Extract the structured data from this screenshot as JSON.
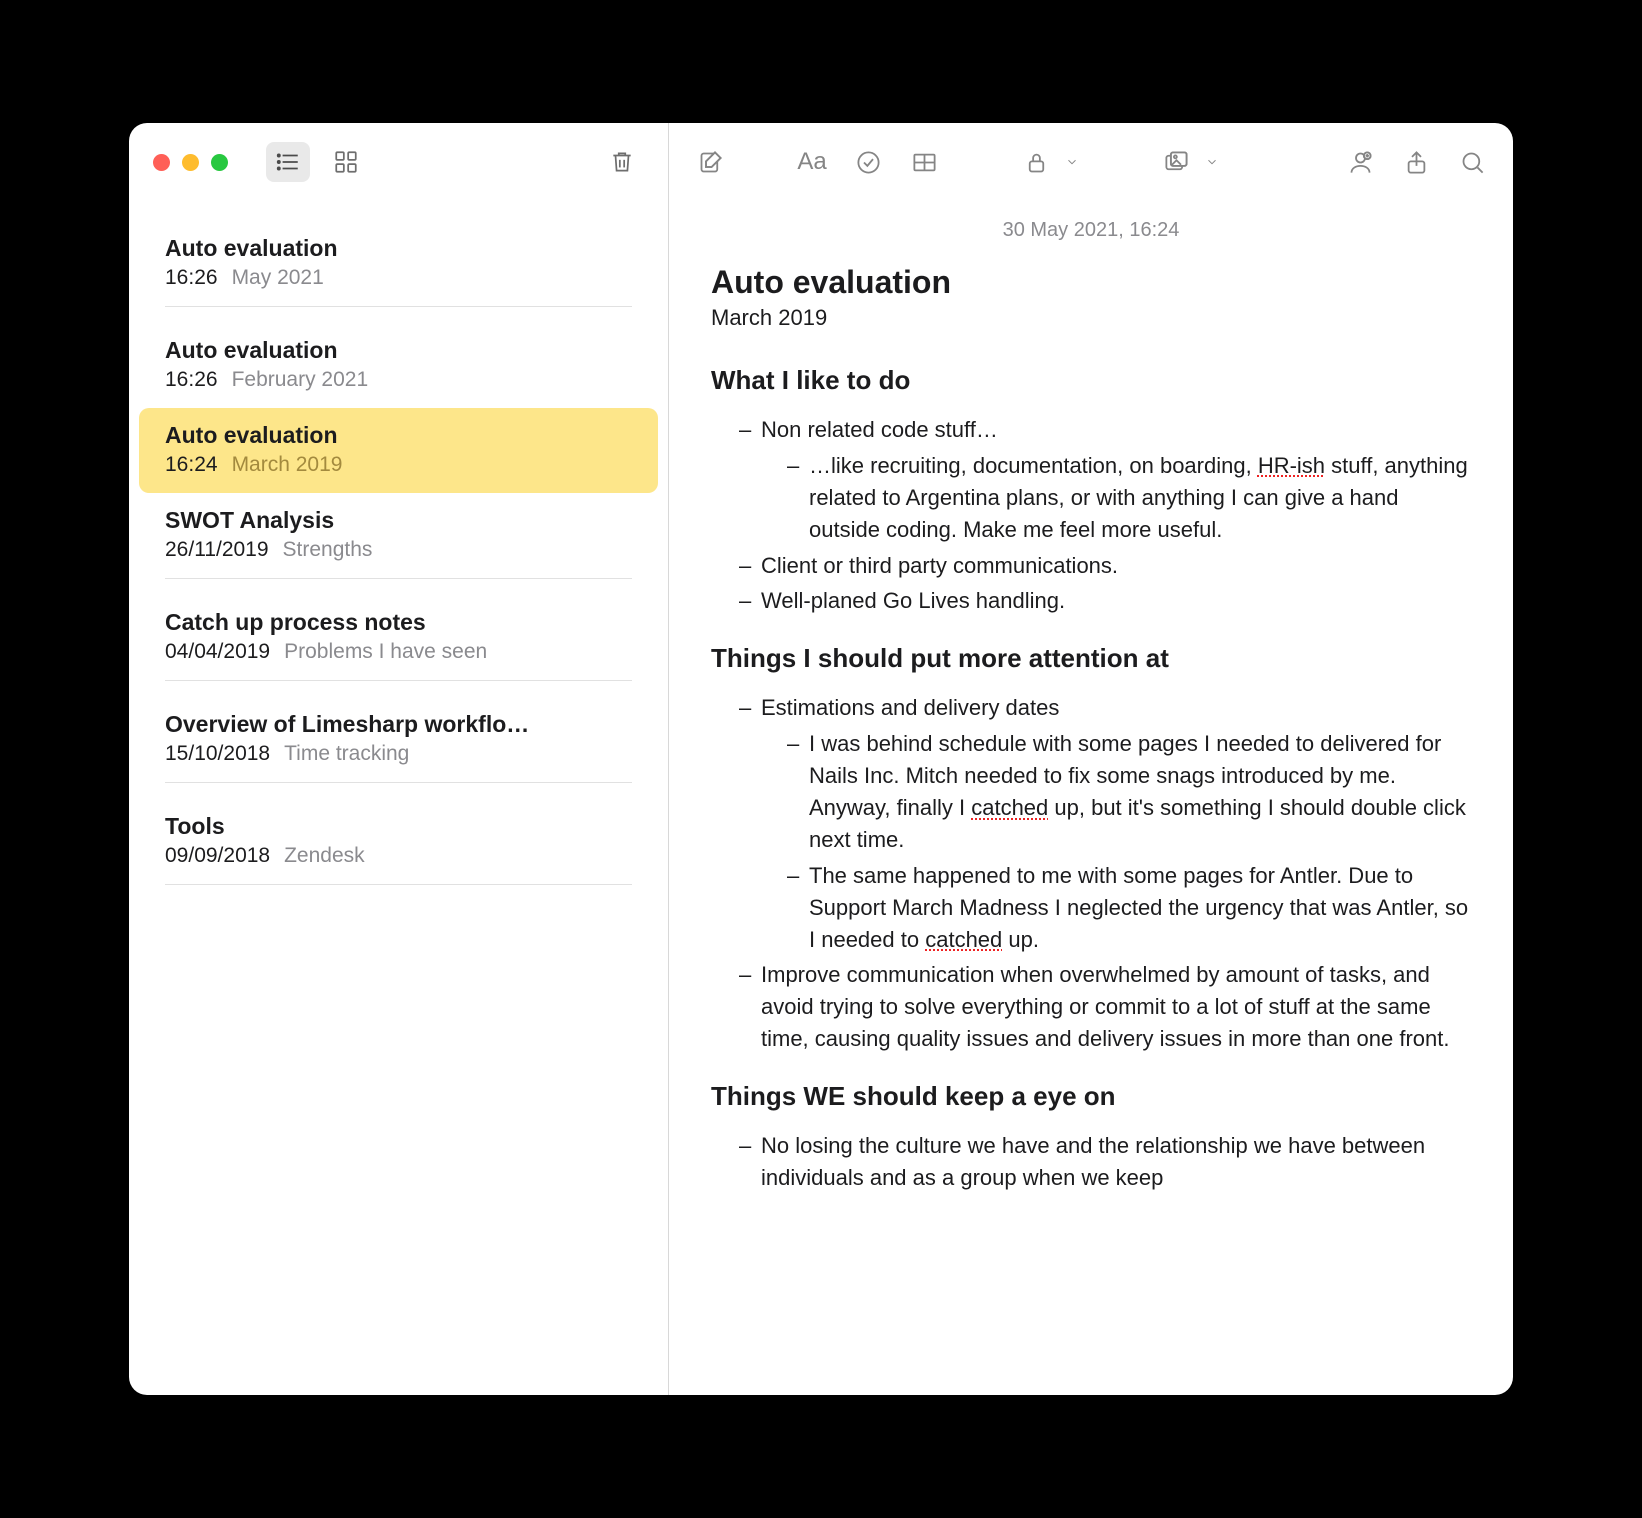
{
  "sidebar": {
    "notes": [
      {
        "title": "Auto evaluation",
        "time": "16:26",
        "preview": "May 2021",
        "selected": false
      },
      {
        "title": "Auto evaluation",
        "time": "16:26",
        "preview": "February 2021",
        "selected": false
      },
      {
        "title": "Auto evaluation",
        "time": "16:24",
        "preview": "March 2019",
        "selected": true
      },
      {
        "title": "SWOT Analysis",
        "time": "26/11/2019",
        "preview": "Strengths",
        "selected": false
      },
      {
        "title": "Catch up process notes",
        "time": "04/04/2019",
        "preview": "Problems I have seen",
        "selected": false
      },
      {
        "title": "Overview of Limesharp workflo…",
        "time": "15/10/2018",
        "preview": "Time tracking",
        "selected": false
      },
      {
        "title": "Tools",
        "time": "09/09/2018",
        "preview": "Zendesk",
        "selected": false
      }
    ]
  },
  "toolbar": {
    "format_label": "Aa"
  },
  "note": {
    "datestamp": "30 May 2021, 16:24",
    "title": "Auto evaluation",
    "subtitle": "March 2019",
    "sections": {
      "s1_heading": "What I like to do",
      "s1_b1": "Non related code stuff…",
      "s1_b1_s1a": "…like recruiting, documentation, on boarding, ",
      "s1_b1_s1_err": "HR-ish",
      "s1_b1_s1b": " stuff, anything related to Argentina plans, or with anything I can give a hand outside coding. Make me feel more useful.",
      "s1_b2": "Client or third party communications.",
      "s1_b3": "Well-planed Go Lives handling.",
      "s2_heading": "Things I should put more attention at",
      "s2_b1": "Estimations and delivery dates",
      "s2_b1_s1a": "I was behind schedule with some pages I needed to delivered for Nails Inc. Mitch needed to fix some snags introduced by me. Anyway, finally I ",
      "s2_b1_s1_err": "catched",
      "s2_b1_s1b": " up, but it's something I should double click next time.",
      "s2_b1_s2a": "The same happened to me with some pages for Antler. Due to Support March Madness I neglected the urgency that was Antler, so I needed to ",
      "s2_b1_s2_err": "catched",
      "s2_b1_s2b": " up.",
      "s2_b2": "Improve communication when overwhelmed by amount of tasks, and avoid trying to solve everything or commit to a lot of stuff at the same time, causing quality issues and delivery issues in more than one front.",
      "s3_heading": "Things WE should keep a eye on",
      "s3_b1": "No losing the culture we have and the relationship we have between individuals and as a group when we keep"
    }
  }
}
